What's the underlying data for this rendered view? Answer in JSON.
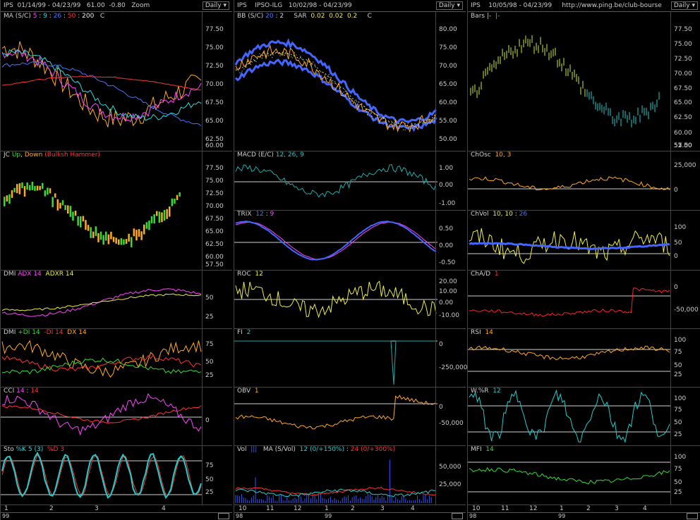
{
  "columns": [
    {
      "header": "IPS  01/14/99 - 04/23/99   61.00  -0.80   Zoom",
      "period": "Daily",
      "panels": [
        {
          "title": [
            {
              "t": "MA (S/C)",
              "c": "#cfcfcf"
            },
            {
              "t": " 5",
              "c": "#ff44ff"
            },
            {
              "t": " : ",
              "c": "#cfcfcf"
            },
            {
              "t": "9",
              "c": "#22dddd"
            },
            {
              "t": " : ",
              "c": "#cfcfcf"
            },
            {
              "t": "26",
              "c": "#4477ff"
            },
            {
              "t": " : ",
              "c": "#cfcfcf"
            },
            {
              "t": "50",
              "c": "#ff3333"
            },
            {
              "t": " : ",
              "c": "#cfcfcf"
            },
            {
              "t": "200",
              "c": "#eeeeee"
            },
            {
              "t": "   C",
              "c": "#cfcfcf"
            }
          ],
          "ticks": [
            "77.50",
            "75.00",
            "72.50",
            "70.00",
            "67.50",
            "65.00",
            "62.50",
            "60.00"
          ]
        },
        {
          "title": [
            {
              "t": "JC ",
              "c": "#cfcfcf"
            },
            {
              "t": "Up",
              "c": "#33dd33"
            },
            {
              "t": ", ",
              "c": "#cfcfcf"
            },
            {
              "t": "Down",
              "c": "#ffaa22"
            },
            {
              "t": " (Bullish Hammer)",
              "c": "#ff3333"
            }
          ],
          "ticks": [
            "77.50",
            "75.00",
            "72.50",
            "70.00",
            "67.50",
            "65.00",
            "62.50",
            "60.00",
            "57.50"
          ]
        },
        {
          "title": [
            {
              "t": "DMI ",
              "c": "#cfcfcf"
            },
            {
              "t": "ADX 14",
              "c": "#ff44ff"
            },
            {
              "t": "  ",
              "c": "#cfcfcf"
            },
            {
              "t": "ADXR 14",
              "c": "#eeee44"
            }
          ],
          "ticks": [
            "50",
            "25"
          ]
        },
        {
          "title": [
            {
              "t": "DMI ",
              "c": "#cfcfcf"
            },
            {
              "t": "+DI 14",
              "c": "#33dd33"
            },
            {
              "t": "  ",
              "c": "#cfcfcf"
            },
            {
              "t": "-DI 14",
              "c": "#ff3333"
            },
            {
              "t": "  ",
              "c": "#cfcfcf"
            },
            {
              "t": "DX 14",
              "c": "#ffaa22"
            }
          ],
          "ticks": [
            "75",
            "50",
            "25"
          ]
        },
        {
          "title": [
            {
              "t": "CCI ",
              "c": "#cfcfcf"
            },
            {
              "t": "14",
              "c": "#ff44ff"
            },
            {
              "t": " : ",
              "c": "#cfcfcf"
            },
            {
              "t": "14",
              "c": "#ff3333"
            }
          ],
          "ticks": [
            "0"
          ]
        },
        {
          "title": [
            {
              "t": "Sto ",
              "c": "#cfcfcf"
            },
            {
              "t": "%K 5 (3)",
              "c": "#22dddd"
            },
            {
              "t": "  ",
              "c": "#cfcfcf"
            },
            {
              "t": "%D 3",
              "c": "#ff3333"
            }
          ],
          "ticks": [
            "75",
            "50",
            "25"
          ]
        }
      ],
      "xlabels": [
        "1",
        "2",
        "3",
        "4"
      ],
      "year": "99"
    },
    {
      "header": "IPS    IPSO-ILG   10/02/98 - 04/23/99",
      "period": "Daily",
      "panels": [
        {
          "title": [
            {
              "t": "BB (S/C) ",
              "c": "#cfcfcf"
            },
            {
              "t": "20",
              "c": "#4477ff"
            },
            {
              "t": " : 2     SAR  ",
              "c": "#cfcfcf"
            },
            {
              "t": "0.02",
              "c": "#eeee44"
            },
            {
              "t": "  ",
              "c": "#cfcfcf"
            },
            {
              "t": "0.02",
              "c": "#eeee44"
            },
            {
              "t": "  ",
              "c": "#cfcfcf"
            },
            {
              "t": "0.2",
              "c": "#eeee44"
            },
            {
              "t": "     C",
              "c": "#cfcfcf"
            }
          ],
          "ticks": [
            "80.00",
            "75.00",
            "70.00",
            "65.00",
            "60.00",
            "55.00",
            "50.00"
          ]
        },
        {
          "title": [
            {
              "t": "MACD (E/C) ",
              "c": "#cfcfcf"
            },
            {
              "t": "12, 26, 9",
              "c": "#22cccc"
            }
          ],
          "ticks": [
            "1.00",
            "0.00",
            "-1.00"
          ]
        },
        {
          "title": [
            {
              "t": "TRIX  ",
              "c": "#cfcfcf"
            },
            {
              "t": "12",
              "c": "#4477ff"
            },
            {
              "t": " : ",
              "c": "#cfcfcf"
            },
            {
              "t": "9",
              "c": "#ff44ff"
            }
          ],
          "ticks": [
            "0.50",
            "0.00",
            "-0.50"
          ]
        },
        {
          "title": [
            {
              "t": "ROC  ",
              "c": "#cfcfcf"
            },
            {
              "t": "12",
              "c": "#eeee44"
            }
          ],
          "ticks": [
            "20.00",
            "10.00",
            "0.00",
            "-10.00"
          ]
        },
        {
          "title": [
            {
              "t": "FI  ",
              "c": "#cfcfcf"
            },
            {
              "t": "2",
              "c": "#22cccc"
            }
          ],
          "ticks": [
            "0",
            "-250,000"
          ]
        },
        {
          "title": [
            {
              "t": "OBV  ",
              "c": "#cfcfcf"
            },
            {
              "t": "1",
              "c": "#ffaa22"
            }
          ],
          "ticks": [
            "0",
            "-50,000"
          ]
        },
        {
          "title": [
            {
              "t": "Vol  ",
              "c": "#cfcfcf"
            },
            {
              "t": "|||",
              "c": "#4466ff"
            },
            {
              "t": "   MA (S/Vol)  ",
              "c": "#cfcfcf"
            },
            {
              "t": "12 (0/+150%)",
              "c": "#22cccc"
            },
            {
              "t": " : ",
              "c": "#cfcfcf"
            },
            {
              "t": "24 (0/+300%)",
              "c": "#ff3333"
            }
          ],
          "ticks": [
            "50,000",
            "25,000"
          ]
        }
      ],
      "xlabels": [
        "10",
        "11",
        "12",
        "1",
        "2",
        "3",
        "4"
      ],
      "years": [
        "98",
        "99"
      ]
    },
    {
      "header": "IPS    10/05/98 - 04/23/99     http://www.ping.be/club-bourse",
      "period": "Daily",
      "panels": [
        {
          "title": [
            {
              "t": "Bars ",
              "c": "#cfcfcf"
            },
            {
              "t": "|-",
              "c": "#ccee33"
            },
            {
              "t": "  ",
              "c": "#cfcfcf"
            },
            {
              "t": "|-",
              "c": "#22cccc"
            }
          ],
          "ticks": [
            "77.50",
            "75.00",
            "72.50",
            "70.00",
            "67.50",
            "65.00",
            "62.50",
            "60.00",
            "57.50",
            "55.00",
            "52.50"
          ]
        },
        {
          "title": [
            {
              "t": "ChOsc  ",
              "c": "#cfcfcf"
            },
            {
              "t": "10, 3",
              "c": "#ffaa22"
            }
          ],
          "ticks": [
            "25,000",
            "0"
          ]
        },
        {
          "title": [
            {
              "t": "ChVol  ",
              "c": "#cfcfcf"
            },
            {
              "t": "10, 10",
              "c": "#eeee44"
            },
            {
              "t": " : ",
              "c": "#cfcfcf"
            },
            {
              "t": "26",
              "c": "#4477ff"
            }
          ],
          "ticks": [
            "100",
            "50",
            "0"
          ]
        },
        {
          "title": [
            {
              "t": "ChA/D  ",
              "c": "#cfcfcf"
            },
            {
              "t": "1",
              "c": "#ff3333"
            }
          ],
          "ticks": [
            "0",
            "-50,000"
          ]
        },
        {
          "title": [
            {
              "t": "RSI  ",
              "c": "#cfcfcf"
            },
            {
              "t": "14",
              "c": "#ffaa22"
            }
          ],
          "ticks": [
            "100",
            "75",
            "50",
            "25"
          ]
        },
        {
          "title": [
            {
              "t": "W.%R  ",
              "c": "#cfcfcf"
            },
            {
              "t": "12",
              "c": "#22cccc"
            }
          ],
          "ticks": [
            "100",
            "75",
            "50",
            "25"
          ]
        },
        {
          "title": [
            {
              "t": "MFI  ",
              "c": "#cfcfcf"
            },
            {
              "t": "14",
              "c": "#33dd33"
            }
          ],
          "ticks": [
            "100",
            "75",
            "50",
            "25"
          ]
        }
      ],
      "xlabels": [
        "10",
        "11",
        "12",
        "1",
        "2",
        "3",
        "4"
      ],
      "years": [
        "98",
        "99"
      ]
    }
  ]
}
